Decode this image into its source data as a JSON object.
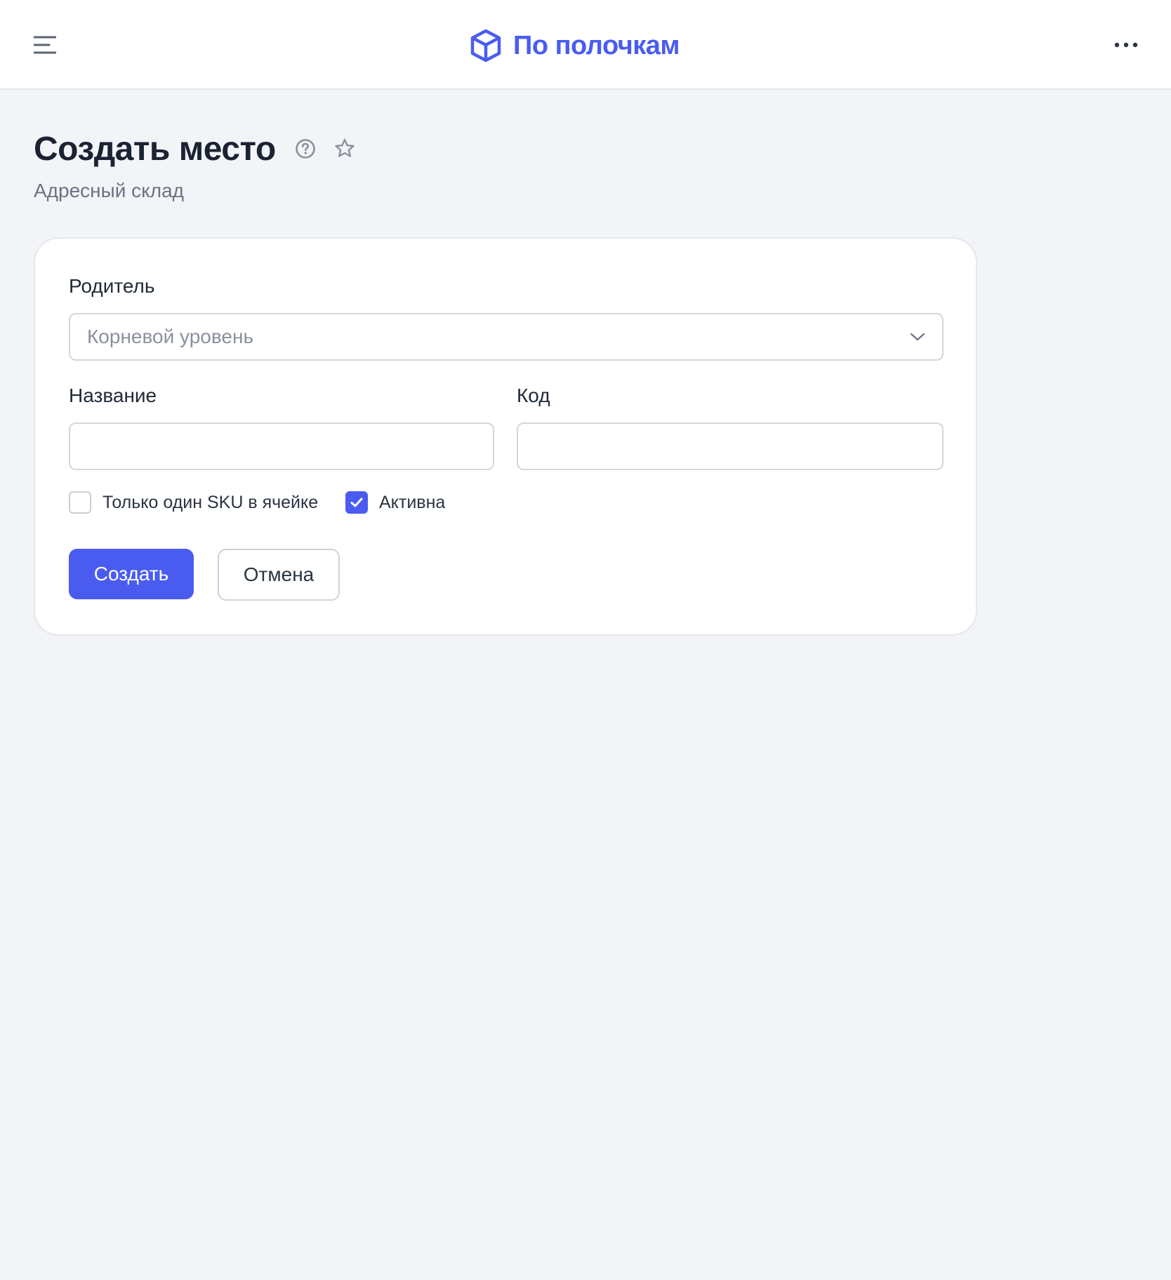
{
  "header": {
    "brand_name": "По полочкам",
    "menu_icon": "hamburger-menu-icon",
    "logo_icon": "cube-icon",
    "more_icon": "more-horizontal-icon",
    "brand_color": "#4a5cf0"
  },
  "page": {
    "title": "Создать место",
    "subtitle": "Адресный склад",
    "help_icon": "help-circle-icon",
    "favorite_icon": "star-icon"
  },
  "form": {
    "parent": {
      "label": "Родитель",
      "value": "Корневой уровень",
      "icon": "chevron-down-icon"
    },
    "name": {
      "label": "Название",
      "value": "",
      "placeholder": ""
    },
    "code": {
      "label": "Код",
      "value": "",
      "placeholder": ""
    },
    "single_sku": {
      "label": "Только один SKU в ячейке",
      "checked": false
    },
    "active": {
      "label": "Активна",
      "checked": true
    },
    "submit_label": "Создать",
    "cancel_label": "Отмена"
  }
}
